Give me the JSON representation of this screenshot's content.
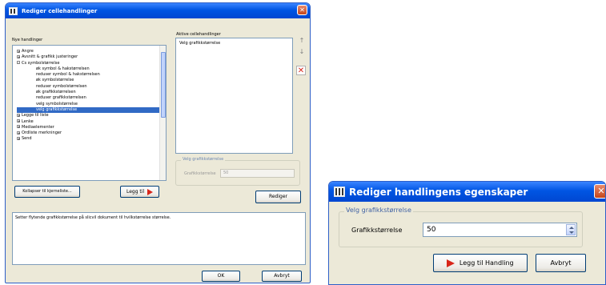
{
  "dialog1": {
    "title": "Rediger cellehandlinger",
    "close_glyph": "✕",
    "left_heading": "Nye handlinger",
    "tree_items": [
      {
        "label": "Angre",
        "expander": "+"
      },
      {
        "label": "Avsnitt & grafikk justeringer",
        "expander": "+"
      },
      {
        "label": "Cs symbolstørrelse",
        "expander": "-"
      },
      {
        "label": "øk symbol & hakstørrelsen",
        "child": true
      },
      {
        "label": "reduser symbol & hakstørrelsen",
        "child": true
      },
      {
        "label": "øk symbolstørrelse",
        "child": true
      },
      {
        "label": "reduser symbolstørrelsen",
        "child": true
      },
      {
        "label": "øk grafikkstørrelsen",
        "child": true
      },
      {
        "label": "reduser grafikkstørrelsen",
        "child": true
      },
      {
        "label": "velg symbolstørrelse",
        "child": true
      },
      {
        "label": "velg grafikkstørrelse",
        "child": true,
        "selected": true
      },
      {
        "label": "Legge til liste",
        "expander": "+"
      },
      {
        "label": "Lenke",
        "expander": "+"
      },
      {
        "label": "Mediaelementer",
        "expander": "+"
      },
      {
        "label": "Ordliste merkninger",
        "expander": "+"
      },
      {
        "label": "Send",
        "expander": "+"
      }
    ],
    "collapse_button": "Kollapser til kjerneliste...",
    "add_button": "Legg til",
    "right_heading": "Aktive cellehandlinger",
    "active_items": [
      "Velg grafikkstørrelse"
    ],
    "move_up_glyph": "↑",
    "move_down_glyph": "↓",
    "delete_glyph": "✕",
    "group_label": "Velg grafikkstørrelse",
    "field_label": "Grafikkstørrelse",
    "field_value": "50",
    "edit_button": "Rediger",
    "description": "Setter flytende grafikkstørrelse på slicvil dokument til hvilkstørrelse størrelse.",
    "ok_button": "OK",
    "cancel_button": "Avbryt"
  },
  "dialog2": {
    "title": "Rediger handlingens egenskaper",
    "close_glyph": "✕",
    "group_label": "Velg grafikkstørrelse",
    "field_label": "Grafikkstørrelse",
    "field_value": "50",
    "add_button": "Legg til Handling",
    "cancel_button": "Avbryt"
  },
  "colors": {
    "titlebar": "#0055e3",
    "window_bg": "#ece9d8",
    "selection": "#316ac5",
    "close": "#c5461b",
    "arrow_red": "#d8261b"
  }
}
